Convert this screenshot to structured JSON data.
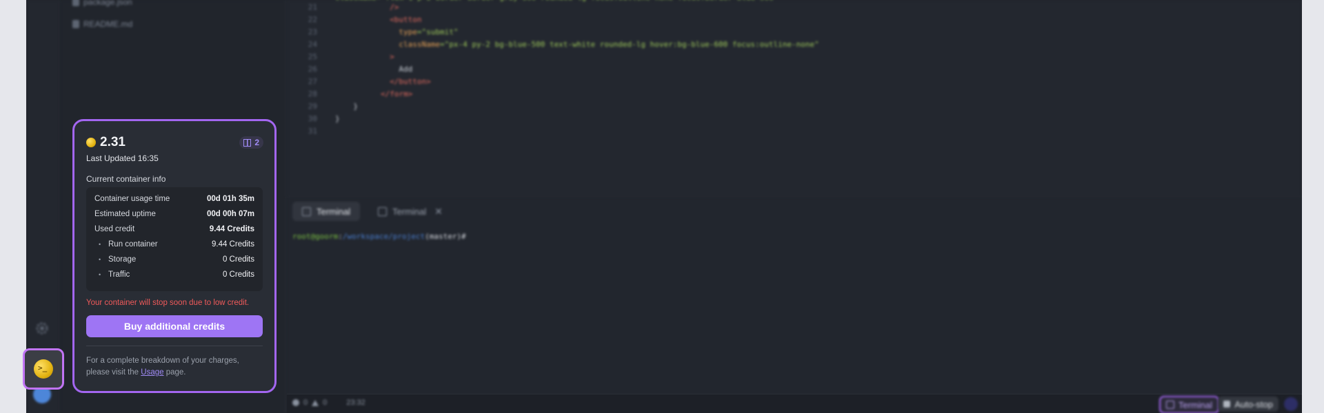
{
  "explorer": {
    "files": [
      {
        "name": "package.json"
      },
      {
        "name": "README.md"
      }
    ]
  },
  "editor": {
    "lines": [
      {
        "n": "21",
        "parts": [
          {
            "t": "/>",
            "c": "kw"
          }
        ],
        "indent": 12
      },
      {
        "n": "22",
        "parts": [
          {
            "t": "<button",
            "c": "kw"
          }
        ],
        "indent": 12
      },
      {
        "n": "23",
        "parts": [
          {
            "t": "type",
            "c": "attr"
          },
          {
            "t": "=\"submit\"",
            "c": "str"
          }
        ],
        "indent": 14
      },
      {
        "n": "24",
        "parts": [
          {
            "t": "className",
            "c": "attr"
          },
          {
            "t": "=\"px-4 py-2 bg-blue-500 text-white rounded-lg hover:bg-blue-600 focus:outline-none\"",
            "c": "str"
          }
        ],
        "indent": 14
      },
      {
        "n": "25",
        "parts": [
          {
            "t": ">",
            "c": "kw"
          }
        ],
        "indent": 12
      },
      {
        "n": "26",
        "parts": [
          {
            "t": "Add",
            "c": "txt"
          }
        ],
        "indent": 14
      },
      {
        "n": "27",
        "parts": [
          {
            "t": "</button>",
            "c": "kw"
          }
        ],
        "indent": 12
      },
      {
        "n": "28",
        "parts": [
          {
            "t": "</form>",
            "c": "kw"
          }
        ],
        "indent": 10
      },
      {
        "n": "29",
        "parts": [
          {
            "t": "}",
            "c": "txt"
          }
        ],
        "indent": 4
      },
      {
        "n": "30",
        "parts": [
          {
            "t": "}",
            "c": "txt"
          }
        ],
        "indent": 0
      },
      {
        "n": "31",
        "parts": [],
        "indent": 0
      }
    ]
  },
  "terminal": {
    "tabs": [
      {
        "label": "Terminal",
        "active": true
      },
      {
        "label": "Terminal",
        "active": false
      }
    ],
    "prompt_user": "root@goorm",
    "prompt_sep": ":",
    "prompt_path": "/workspace/project",
    "prompt_branch": "(master)#"
  },
  "statusbar": {
    "errors": "0",
    "warnings": "0",
    "time": "23:32",
    "terminal_label": "Terminal",
    "autostop_label": "Auto-stop"
  },
  "credit_popup": {
    "balance": "2.31",
    "last_updated": "Last Updated 16:35",
    "container_count": "2",
    "section_title": "Current container info",
    "rows": [
      {
        "label": "Container usage time",
        "value": "00d 01h 35m",
        "sub": false
      },
      {
        "label": "Estimated uptime",
        "value": "00d 00h 07m",
        "sub": false
      },
      {
        "label": "Used credit",
        "value": "9.44 Credits",
        "sub": false
      },
      {
        "label": "Run container",
        "value": "9.44 Credits",
        "sub": true
      },
      {
        "label": "Storage",
        "value": "0 Credits",
        "sub": true
      },
      {
        "label": "Traffic",
        "value": "0 Credits",
        "sub": true
      }
    ],
    "warning": "Your container will stop soon due to low credit.",
    "buy_label": "Buy additional credits",
    "footer_text_1": "For a complete breakdown of your charges,",
    "footer_text_2a": "please visit the ",
    "footer_link": "Usage",
    "footer_text_2b": " page."
  },
  "colors": {
    "accent": "#9e75f4",
    "highlight": "#a366f0",
    "warning": "#f05a5a",
    "coin": "#e3b413"
  }
}
